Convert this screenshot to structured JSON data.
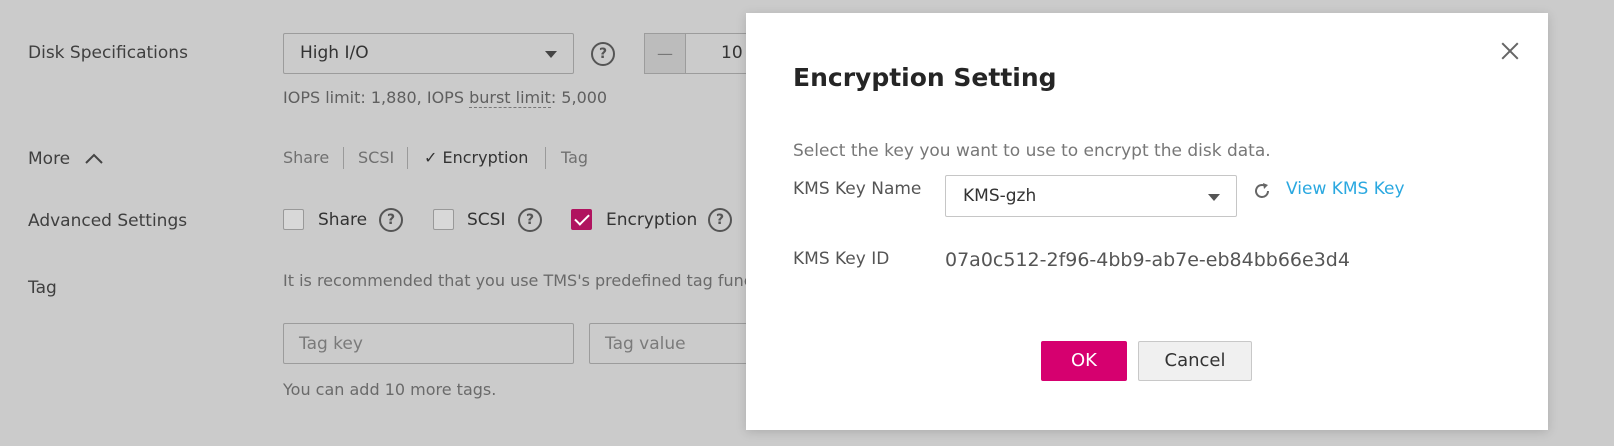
{
  "form": {
    "disk_specs": {
      "label": "Disk Specifications",
      "type_value": "High I/O",
      "help": "?",
      "stepper_minus": "—",
      "stepper_value": "10",
      "iops_note_prefix": "IOPS limit: 1,880, IOPS ",
      "iops_note_link": "burst limit",
      "iops_note_suffix": ": 5,000"
    },
    "more": {
      "label": "More",
      "options": [
        "Share",
        "SCSI",
        "Encryption",
        "Tag"
      ],
      "checkmark": "✓"
    },
    "advanced": {
      "label": "Advanced Settings",
      "share": "Share",
      "scsi": "SCSI",
      "encryption": "Encryption",
      "help": "?"
    },
    "tag": {
      "label": "Tag",
      "recommendation": "It is recommended that you use TMS's predefined tag func",
      "key_placeholder": "Tag key",
      "value_placeholder": "Tag value",
      "remaining": "You can add 10 more tags."
    }
  },
  "modal": {
    "title": "Encryption Setting",
    "description": "Select the key you want to use to encrypt the disk data.",
    "kms_key_name_label": "KMS Key Name",
    "kms_key_name_value": "KMS-gzh",
    "view_kms_key": "View KMS Key",
    "kms_key_id_label": "KMS Key ID",
    "kms_key_id_value": "07a0c512-2f96-4bb9-ab7e-eb84bb66e3d4",
    "ok": "OK",
    "cancel": "Cancel"
  },
  "colors": {
    "overlay_bg": "#cbcbcb",
    "accent": "#d6006f",
    "link": "#2aa8e0"
  }
}
